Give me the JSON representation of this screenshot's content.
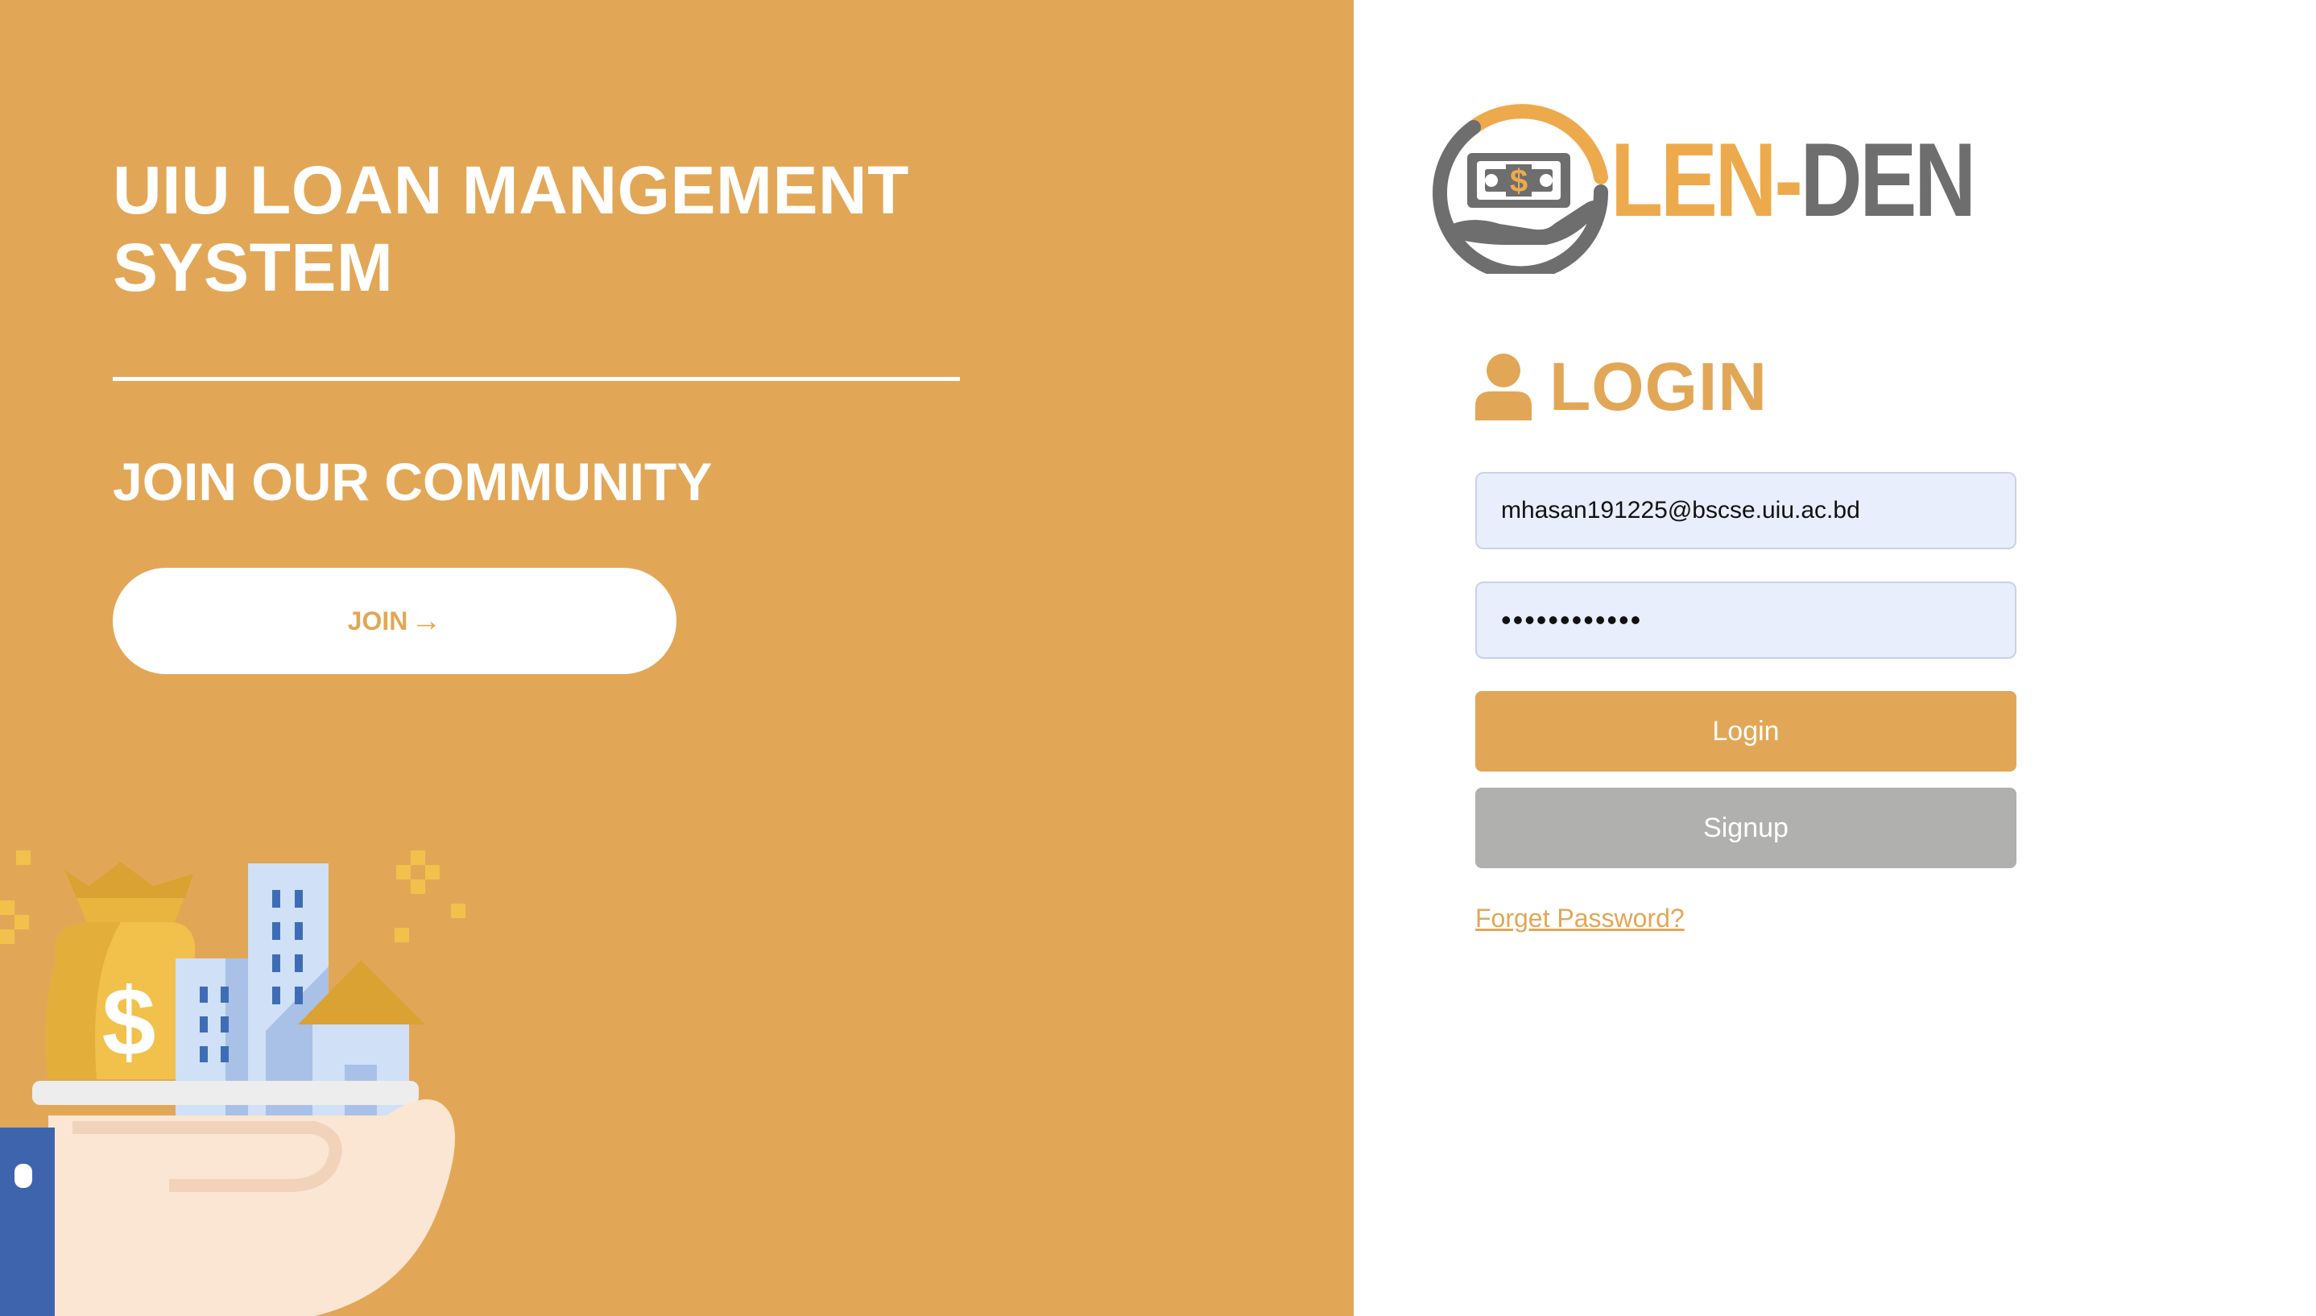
{
  "hero": {
    "title": "UIU LOAN MANGEMENT SYSTEM",
    "subtitle": "JOIN OUR COMMUNITY",
    "join_label": "JOIN",
    "join_icon": "arrow-right-icon"
  },
  "brand": {
    "name_part1": "LEN-",
    "name_part2": "DEN",
    "logo_icon": "money-hand-logo-icon"
  },
  "login": {
    "heading": "LOGIN",
    "heading_icon": "user-icon",
    "email_value": "mhasan191225@bscse.uiu.ac.bd",
    "password_value": "••••••••••••",
    "login_label": "Login",
    "signup_label": "Signup",
    "forgot_label": "Forget Password?"
  },
  "colors": {
    "accent": "#E2A756",
    "muted_button": "#B0B0AF",
    "input_background": "#E8EEFB"
  }
}
